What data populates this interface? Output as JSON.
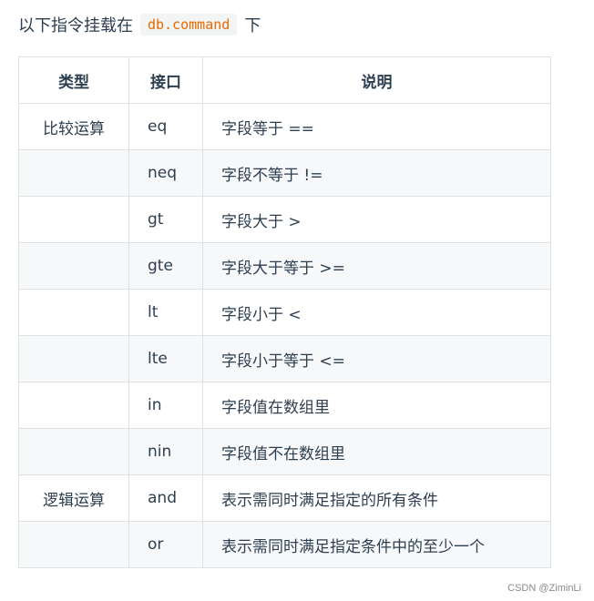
{
  "intro": {
    "prefix": "以下指令挂载在",
    "code": "db.command",
    "suffix": "下"
  },
  "table": {
    "headers": [
      "类型",
      "接口",
      "说明"
    ],
    "rows": [
      {
        "type": "比较运算",
        "api": "eq",
        "desc": "字段等于 =="
      },
      {
        "type": "",
        "api": "neq",
        "desc": "字段不等于 !="
      },
      {
        "type": "",
        "api": "gt",
        "desc": "字段大于 >"
      },
      {
        "type": "",
        "api": "gte",
        "desc": "字段大于等于 >="
      },
      {
        "type": "",
        "api": "lt",
        "desc": "字段小于 <"
      },
      {
        "type": "",
        "api": "lte",
        "desc": "字段小于等于 <="
      },
      {
        "type": "",
        "api": "in",
        "desc": "字段值在数组里"
      },
      {
        "type": "",
        "api": "nin",
        "desc": "字段值不在数组里"
      },
      {
        "type": "逻辑运算",
        "api": "and",
        "desc": "表示需同时满足指定的所有条件"
      },
      {
        "type": "",
        "api": "or",
        "desc": "表示需同时满足指定条件中的至少一个"
      }
    ]
  },
  "watermark": "CSDN @ZiminLi",
  "colors": {
    "text": "#2c3e50",
    "code_text": "#e96900",
    "code_bg": "#f3f4f4",
    "border": "#dfe2e5",
    "stripe": "#f6f8fa"
  }
}
